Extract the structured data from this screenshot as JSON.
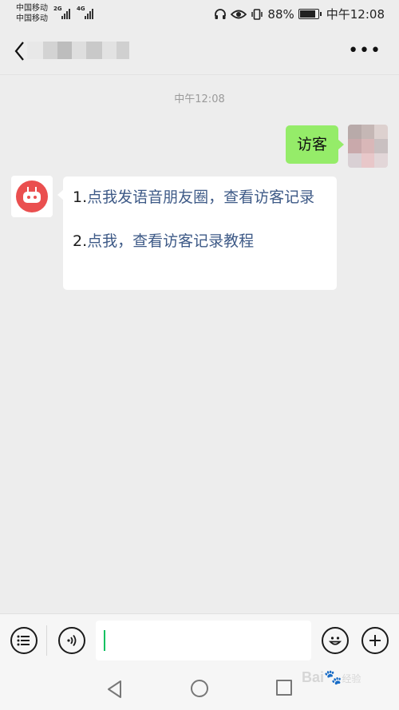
{
  "status_bar": {
    "carrier_1": "中国移动",
    "carrier_2": "中国移动",
    "network_1": "2G",
    "network_2": "4G",
    "battery": "88%",
    "time": "中午12:08",
    "icons": [
      "headphones-icon",
      "eye-comfort-icon",
      "vibrate-icon",
      "battery-icon"
    ]
  },
  "header": {
    "back_icon": "chevron-left-icon",
    "more_label": "•••"
  },
  "chat": {
    "time_divider": "中午12:08",
    "outgoing": {
      "text": "访客"
    },
    "incoming": {
      "line1_prefix": "1.",
      "line1_link": "点我发语音朋友圈，查看访客记录",
      "line2_prefix": "2.",
      "line2_link": "点我，查看访客记录教程"
    }
  },
  "input_bar": {
    "value": "",
    "icons": [
      "menu-list-icon",
      "voice-icon",
      "emoji-icon",
      "plus-icon"
    ]
  },
  "nav_bar": {
    "icons": [
      "nav-back-icon",
      "nav-home-icon",
      "nav-recent-icon"
    ]
  },
  "watermark": {
    "text": "Bai",
    "suffix": "经验"
  },
  "colors": {
    "background": "#ededed",
    "outgoing_bubble": "#95ec69",
    "incoming_bubble": "#ffffff",
    "link": "#3e5a87",
    "bot_avatar": "#ea4f4f",
    "cursor": "#07c160"
  }
}
